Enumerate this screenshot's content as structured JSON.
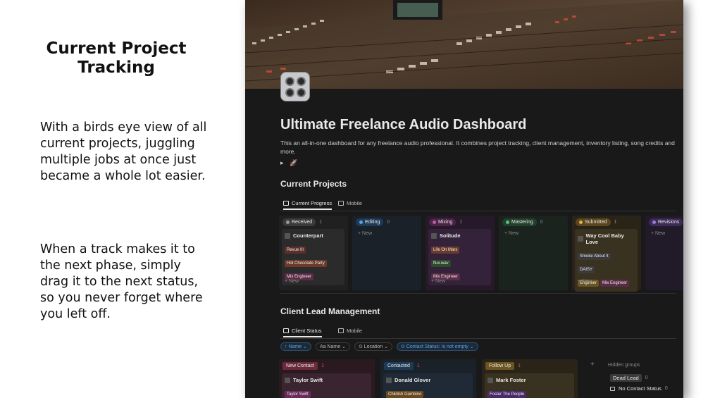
{
  "promo": {
    "headline": "Current Project\nTracking",
    "paragraph1": "With a birds eye view of all current projects, juggling multiple jobs at once just became a whole lot easier.",
    "paragraph2": "When a track makes it to the next phase, simply drag it to the next status, so you never forget where you left off."
  },
  "page": {
    "title": "Ultimate Freelance Audio Dashboard",
    "description": "This an all-in-one dashboard for any freelance audio professional. It combines project tracking, client management, inventory listing, song credits and more.",
    "toggle_arrow": "▸",
    "toggle_emoji": "🚀"
  },
  "current_projects": {
    "title": "Current Projects",
    "tabs": [
      {
        "label": "Current Progress",
        "icon": "board-icon"
      },
      {
        "label": "Mobile",
        "icon": "grid-icon"
      }
    ],
    "new_label": "+ New",
    "columns": [
      {
        "status": "Received",
        "count": "1",
        "pill_bg": "#3a3a3a",
        "dot": "#9b9b9b",
        "col_bg": "#202020",
        "card_bg": "#2b2b2b",
        "card": {
          "title": "Counterpart",
          "tags": [
            {
              "text": "Revue III",
              "bg": "#5c2f2a"
            },
            {
              "text": "Hot Chocolate Party",
              "bg": "#6b3a2a"
            },
            {
              "text": "Mix Engineer",
              "bg": "#5a2c47"
            }
          ]
        }
      },
      {
        "status": "Editing",
        "count": "0",
        "pill_bg": "#1e3a55",
        "dot": "#5aa2e8",
        "col_bg": "#1a2129",
        "card_bg": "#1f2a36",
        "card": null
      },
      {
        "status": "Mixing",
        "count": "1",
        "pill_bg": "#4a2345",
        "dot": "#c05aa5",
        "col_bg": "#26192a",
        "card_bg": "#33223a",
        "card": {
          "title": "Solitude",
          "tags": [
            {
              "text": "Life On Mars",
              "bg": "#6b3a2a"
            },
            {
              "text": "flux.wav",
              "bg": "#2d4a2c"
            },
            {
              "text": "Mix Engineer",
              "bg": "#5a2c47"
            }
          ]
        }
      },
      {
        "status": "Mastering",
        "count": "0",
        "pill_bg": "#23402d",
        "dot": "#5ac07a",
        "col_bg": "#1a231d",
        "card_bg": "#202d24",
        "card": null
      },
      {
        "status": "Submitted",
        "count": "1",
        "pill_bg": "#5a4520",
        "dot": "#e0b04a",
        "col_bg": "#2a2418",
        "card_bg": "#3a3220",
        "card": {
          "title": "Way Cool Baby Love",
          "tags": [
            {
              "text": "Smoke About It",
              "bg": "#3a3a3a"
            },
            {
              "text": "DAISY",
              "bg": "#3a3a3a"
            },
            {
              "text": "Engineer",
              "bg": "#6b5420"
            },
            {
              "text": "Mix Engineer",
              "bg": "#5a2c47"
            }
          ]
        }
      },
      {
        "status": "Revisions",
        "count": "",
        "pill_bg": "#3d2a55",
        "dot": "#a07ae0",
        "col_bg": "#211a29",
        "card_bg": "#2a2236",
        "card": null
      }
    ]
  },
  "client_leads": {
    "title": "Client Lead Management",
    "tabs": [
      {
        "label": "Client Status",
        "icon": "board-icon"
      },
      {
        "label": "Mobile",
        "icon": "grid-icon"
      }
    ],
    "filters": [
      {
        "label": "↑ Name ⌄",
        "style": "blue"
      },
      {
        "label": "Aa Name ⌄",
        "style": "plain"
      },
      {
        "label": "⊙ Location ⌄",
        "style": "plain"
      },
      {
        "label": "⊙ Contact Status: Is not empty ⌄",
        "style": "blue"
      }
    ],
    "columns": [
      {
        "status": "New Contact",
        "count": "1",
        "pill_bg": "#6b2a3a",
        "col_bg": "#2a1a20",
        "card_bg": "#3a2430",
        "card": {
          "title": "Taylor Swift",
          "tag": {
            "text": "Taylor Swift",
            "bg": "#6b2a5a"
          }
        }
      },
      {
        "status": "Contacted",
        "count": "1",
        "pill_bg": "#1e3a55",
        "col_bg": "#1a2129",
        "card_bg": "#1f2a36",
        "card": {
          "title": "Donald Glover",
          "tag": {
            "text": "Childish Gambino",
            "bg": "#6b4a20"
          }
        }
      },
      {
        "status": "Follow Up",
        "count": "1",
        "pill_bg": "#6b5420",
        "col_bg": "#2a2418",
        "card_bg": "#3a3220",
        "card": {
          "title": "Mark Foster",
          "tag": {
            "text": "Foster The People",
            "bg": "#4a2a6b"
          }
        }
      }
    ],
    "hidden_groups": {
      "label": "Hidden groups",
      "plus": "+",
      "items": [
        {
          "label": "Dead Lead",
          "count": "0"
        },
        {
          "label": "No Contact Status",
          "count": "0"
        }
      ]
    }
  }
}
